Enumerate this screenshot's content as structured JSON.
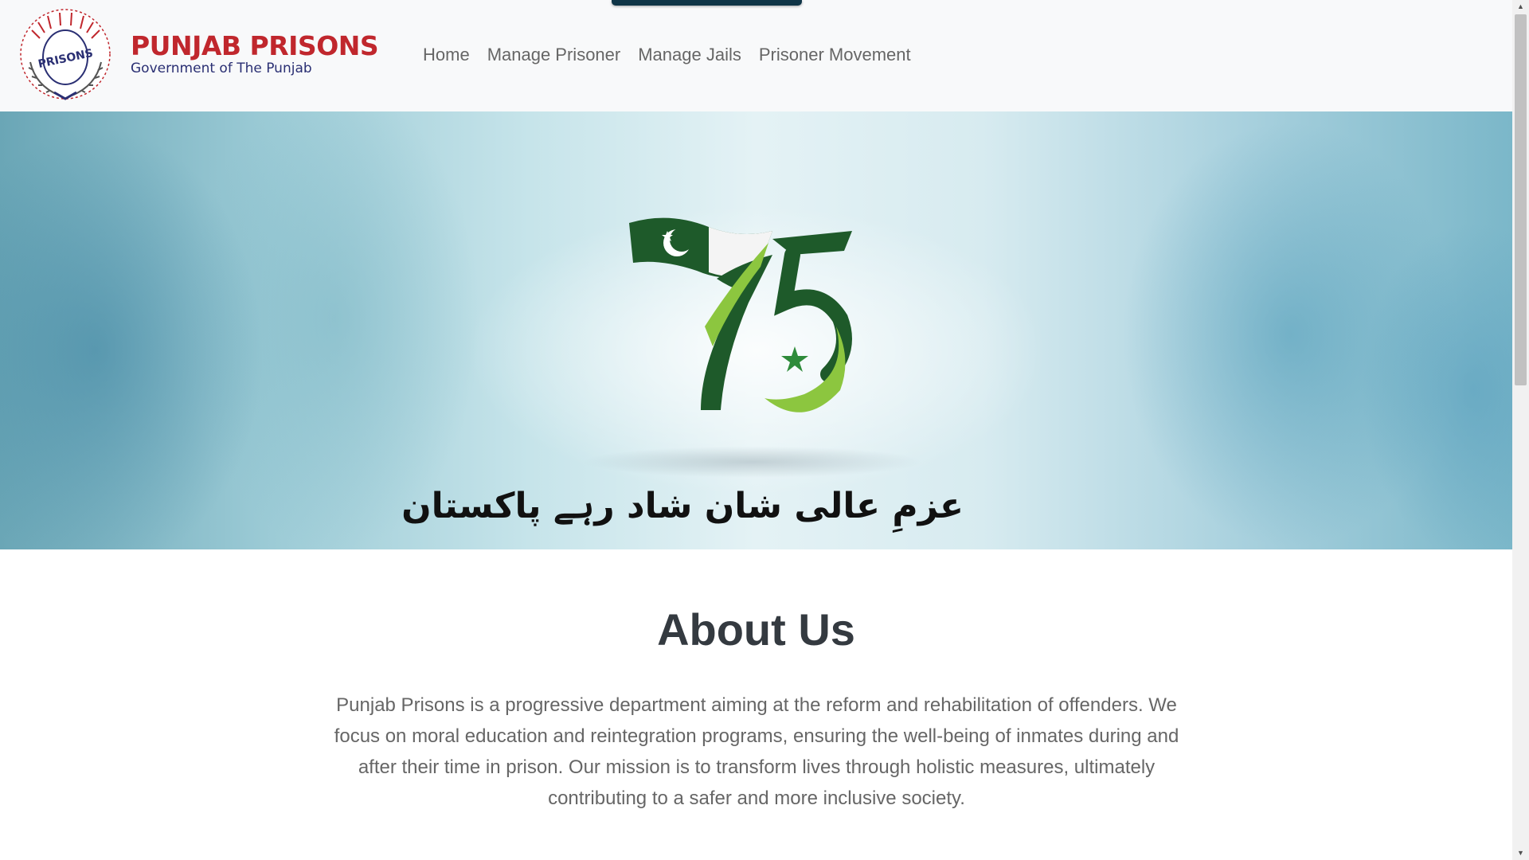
{
  "brand": {
    "name": "PUNJAB PRISONS",
    "subtitle": "Government of The Punjab",
    "emblem_text": "PRISONS"
  },
  "nav": {
    "items": [
      {
        "label": "Home"
      },
      {
        "label": "Manage Prisoner"
      },
      {
        "label": "Manage Jails"
      },
      {
        "label": "Prisoner Movement"
      }
    ]
  },
  "hero": {
    "logo_number": "75",
    "slogan": "عزمِ عالی شان شاد رہے پاکستان"
  },
  "about": {
    "title": "About Us",
    "body": "Punjab Prisons is a progressive department aiming at the reform and rehabilitation of offenders. We focus on moral education and reintegration programs, ensuring the well-being of inmates during and after their time in prison. Our mission is to transform lives through holistic measures, ultimately contributing to a safer and more inclusive society."
  },
  "colors": {
    "brand_red": "#c0272d",
    "brand_navy": "#2a2f73",
    "flag_green": "#1e5a2a",
    "accent_green": "#8cc63f"
  },
  "icons": {
    "scroll_up": "scroll-up-arrow-icon",
    "scroll_down": "scroll-down-arrow-icon"
  }
}
